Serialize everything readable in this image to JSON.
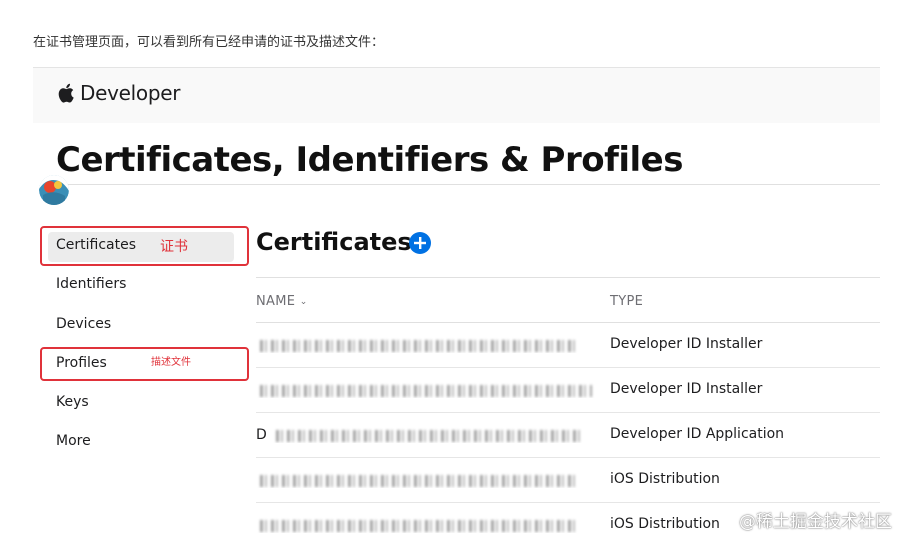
{
  "intro_text": "在证书管理页面，可以看到所有已经申请的证书及描述文件：",
  "header": {
    "brand": "Developer"
  },
  "page_title": "Certificates, Identifiers & Profiles",
  "sidebar": {
    "items": [
      {
        "label": "Certificates",
        "active": true
      },
      {
        "label": "Identifiers"
      },
      {
        "label": "Devices"
      },
      {
        "label": "Profiles"
      },
      {
        "label": "Keys"
      },
      {
        "label": "More"
      }
    ]
  },
  "annotations": {
    "certificates_note": "证书",
    "profiles_note": "描述文件",
    "color": "#e0323a"
  },
  "section": {
    "title": "Certificates",
    "add_icon": "plus-circle-icon"
  },
  "table": {
    "columns": [
      "NAME",
      "TYPE"
    ],
    "rows": [
      {
        "name_prefix": "",
        "type": "Developer ID Installer"
      },
      {
        "name_prefix": "",
        "type": "Developer ID Installer"
      },
      {
        "name_prefix": "D",
        "type": "Developer ID Application"
      },
      {
        "name_prefix": "",
        "type": "iOS Distribution"
      },
      {
        "name_prefix": "",
        "type": "iOS Distribution"
      }
    ]
  },
  "watermark": "@稀土掘金技术社区",
  "colors": {
    "accent": "#0071e3",
    "annotation": "#e0323a"
  }
}
